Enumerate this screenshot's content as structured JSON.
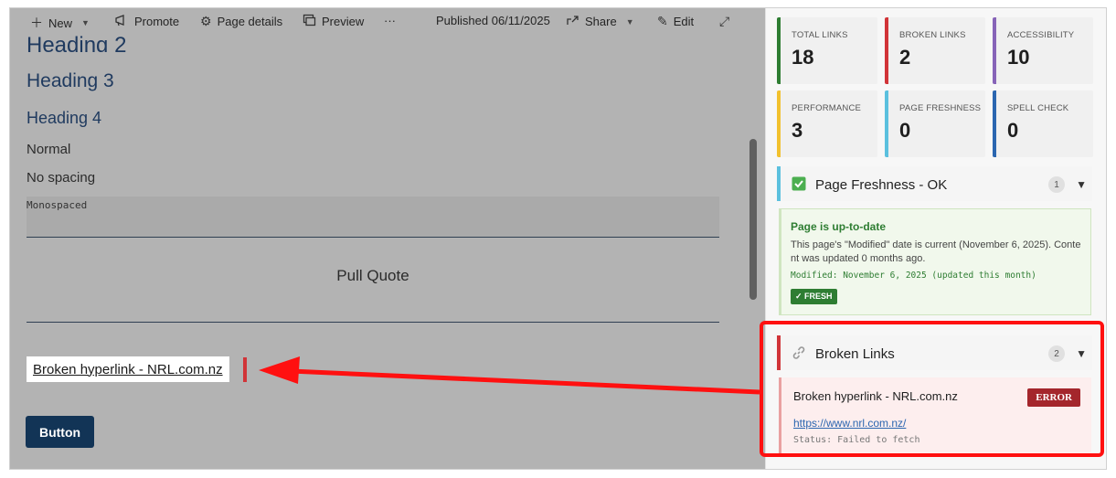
{
  "toolbar": {
    "new": "New",
    "promote": "Promote",
    "page_details": "Page details",
    "preview": "Preview",
    "more": "···",
    "published": "Published 06/11/2025",
    "share": "Share",
    "edit": "Edit"
  },
  "content": {
    "h2": "Heading 2",
    "h3": "Heading 3",
    "h4": "Heading 4",
    "normal": "Normal",
    "no_spacing": "No spacing",
    "monospaced": "Monospaced",
    "pull_quote": "Pull Quote",
    "broken_link": "Broken hyperlink - NRL.com.nz",
    "button": "Button"
  },
  "stats": [
    {
      "label": "TOTAL LINKS",
      "value": "18",
      "color": "#2e7d32"
    },
    {
      "label": "BROKEN LINKS",
      "value": "2",
      "color": "#d13438"
    },
    {
      "label": "ACCESSIBILITY",
      "value": "10",
      "color": "#8764b8"
    },
    {
      "label": "PERFORMANCE",
      "value": "3",
      "color": "#f2c12e"
    },
    {
      "label": "PAGE FRESHNESS",
      "value": "0",
      "color": "#5bc0de"
    },
    {
      "label": "SPELL CHECK",
      "value": "0",
      "color": "#2b66b0"
    }
  ],
  "freshness": {
    "title": "Page Freshness - OK",
    "count": "1",
    "card_title": "Page is up-to-date",
    "card_desc": "This page's \"Modified\" date is current (November 6, 2025). Content was updated 0 months ago.",
    "card_modified": "Modified: November 6, 2025 (updated this month)",
    "badge": "✓ FRESH"
  },
  "broken": {
    "title": "Broken Links",
    "count": "2",
    "card_title": "Broken hyperlink - NRL.com.nz",
    "badge": "ERROR",
    "url": "https://www.nrl.com.nz/",
    "status": "Status: Failed to fetch"
  }
}
